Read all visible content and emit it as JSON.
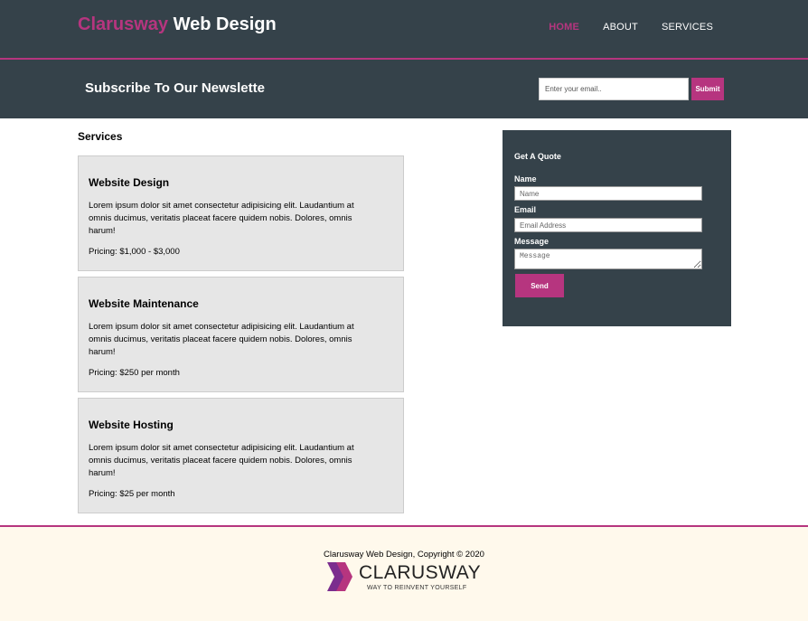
{
  "header": {
    "logo_accent": "Clarusway",
    "logo_rest": "Web Design",
    "nav": [
      {
        "label": "HOME",
        "active": true
      },
      {
        "label": "ABOUT",
        "active": false
      },
      {
        "label": "SERVICES",
        "active": false
      }
    ]
  },
  "newsletter": {
    "title": "Subscribe To Our Newslette",
    "email_placeholder": "Enter your email..",
    "submit_label": "Submit"
  },
  "services": {
    "title": "Services",
    "items": [
      {
        "name": "Website Design",
        "description": "Lorem ipsum dolor sit amet consectetur adipisicing elit. Laudantium at omnis ducimus, veritatis placeat facere quidem nobis. Dolores, omnis harum!",
        "pricing": "Pricing: $1,000 - $3,000"
      },
      {
        "name": "Website Maintenance",
        "description": "Lorem ipsum dolor sit amet consectetur adipisicing elit. Laudantium at omnis ducimus, veritatis placeat facere quidem nobis. Dolores, omnis harum!",
        "pricing": "Pricing: $250 per month"
      },
      {
        "name": "Website Hosting",
        "description": "Lorem ipsum dolor sit amet consectetur adipisicing elit. Laudantium at omnis ducimus, veritatis placeat facere quidem nobis. Dolores, omnis harum!",
        "pricing": "Pricing: $25 per month"
      }
    ]
  },
  "quote": {
    "title": "Get A Quote",
    "name_label": "Name",
    "name_placeholder": "Name",
    "email_label": "Email",
    "email_placeholder": "Email Address",
    "message_label": "Message",
    "message_placeholder": "Message",
    "send_label": "Send"
  },
  "footer": {
    "copyright": "Clarusway Web Design, Copyright © 2020",
    "brand_name": "CLARUSWAY",
    "brand_tagline": "WAY TO REINVENT YOURSELF"
  },
  "colors": {
    "dark": "#35424a",
    "accent": "#b6357f",
    "card": "#e6e6e6",
    "footer_bg": "#fff9ec"
  }
}
